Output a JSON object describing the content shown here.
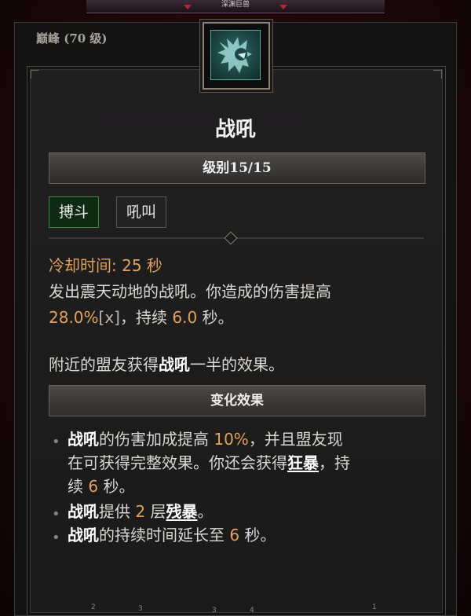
{
  "window": {
    "top_header_title": "深渊巨兽"
  },
  "panel": {
    "title": "巅峰 (70 级)"
  },
  "skill": {
    "icon": "war-cry-skill-icon",
    "name": "战吼",
    "rank_label": "级别15/15",
    "tags": [
      {
        "label": "搏斗",
        "active": true
      },
      {
        "label": "吼叫",
        "active": false
      }
    ],
    "cooldown": {
      "label": "冷却时间:",
      "value": "25",
      "unit": "秒"
    },
    "description": {
      "line1": "发出震天动地的战吼。你造成的伤害提高",
      "damage_value": "28.0%",
      "multiplier_suffix": "[x]",
      "duration_prefix": "，持续",
      "duration_value": "6.0",
      "duration_unit": "秒。"
    },
    "allies_note": {
      "prefix": "附近的盟友获得",
      "skill": "战吼",
      "suffix": "一半的效果。"
    }
  },
  "enhancement": {
    "header": "变化效果",
    "bullets": [
      {
        "skill": "战吼",
        "part1": "的伤害加成提高",
        "value": "10%",
        "part2": "，并且盟友现",
        "line2": "在可获得完整效果。你还会获得",
        "keyword": "狂暴",
        "part3": "，持",
        "line3_prefix": "续",
        "line3_value": "6",
        "line3_suffix": "秒。"
      },
      {
        "skill": "战吼",
        "part1": "提供",
        "value": "2",
        "part2": "层",
        "keyword": "残暴",
        "end": "。"
      },
      {
        "skill": "战吼",
        "part1": "的持续时间延长至",
        "value": "6",
        "part2": "秒。"
      }
    ]
  },
  "bottom_hotkeys": [
    "2",
    "3",
    "3",
    "4",
    "1"
  ],
  "colors": {
    "accent_orange": "#e0a25c",
    "active_tag_green": "#3f8a3f",
    "icon_teal": "#2f6e6c"
  }
}
